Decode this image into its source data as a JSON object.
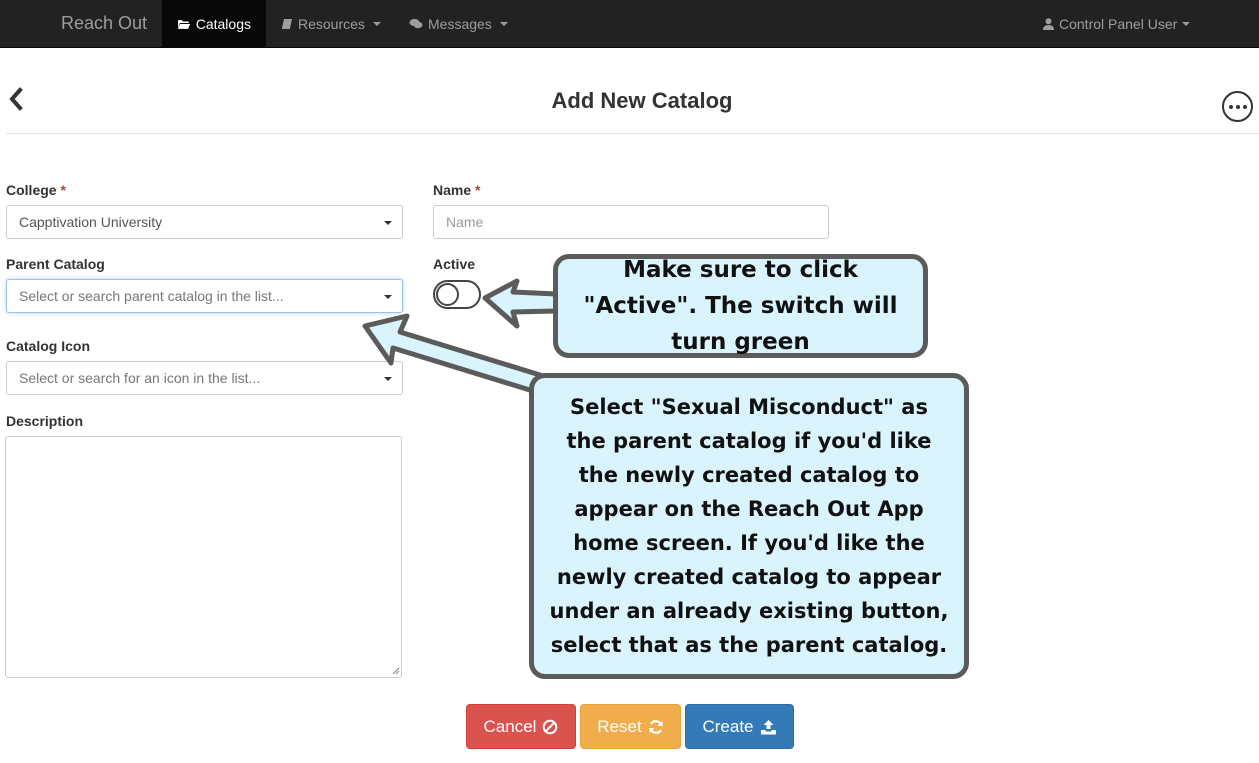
{
  "navbar": {
    "brand": "Reach Out",
    "items": [
      {
        "label": "Catalogs",
        "icon": "folder-open-icon",
        "active": true
      },
      {
        "label": "Resources",
        "icon": "book-icon",
        "active": false
      },
      {
        "label": "Messages",
        "icon": "comments-icon",
        "active": false
      }
    ],
    "user": {
      "label": "Control Panel User",
      "icon": "user-icon"
    }
  },
  "header": {
    "title": "Add New Catalog",
    "back_icon": "chevron-left-icon",
    "more_icon": "ellipsis-circle-icon"
  },
  "form": {
    "college": {
      "label": "College",
      "required_mark": "*",
      "value": "Capptivation University"
    },
    "name": {
      "label": "Name",
      "required_mark": "*",
      "placeholder": "Name"
    },
    "parent_catalog": {
      "label": "Parent Catalog",
      "placeholder": "Select or search parent catalog in the list..."
    },
    "active": {
      "label": "Active",
      "on": false
    },
    "catalog_icon": {
      "label": "Catalog Icon",
      "placeholder": "Select or search for an icon in the list..."
    },
    "description": {
      "label": "Description",
      "value": ""
    }
  },
  "buttons": {
    "cancel": {
      "label": "Cancel",
      "icon": "ban-icon",
      "color": "#d9534f"
    },
    "reset": {
      "label": "Reset",
      "icon": "refresh-icon",
      "color": "#f0ad4e"
    },
    "create": {
      "label": "Create",
      "icon": "upload-icon",
      "color": "#337ab7"
    }
  },
  "annotations": {
    "active_note": "Make sure to click \"Active\". The switch will turn green",
    "parent_note": "Select \"Sexual Misconduct\" as the parent catalog if you'd like the newly created catalog to appear on the Reach Out App home screen. If you'd like the newly created catalog to appear under an already existing button, select that as the parent catalog."
  },
  "colors": {
    "navbar_bg": "#222222",
    "callout_bg": "#d9f4fc",
    "callout_border": "#5b5b5b",
    "required": "#a94442"
  }
}
